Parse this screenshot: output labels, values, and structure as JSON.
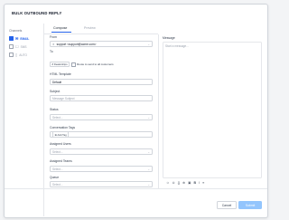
{
  "modal": {
    "title": "BULK OUTBOUND REPLY"
  },
  "channels": {
    "heading": "Channels",
    "items": [
      {
        "label": "EMAIL",
        "icon": "mail-icon",
        "active": true
      },
      {
        "label": "SMS",
        "icon": "phone-icon",
        "active": false
      },
      {
        "label": "AUTO",
        "icon": "device-icon",
        "active": false
      }
    ]
  },
  "tabs": [
    {
      "label": "Compose",
      "active": true
    },
    {
      "label": "Preview",
      "active": false
    }
  ],
  "form": {
    "from_label": "From",
    "from_value": "support <support@acme.com>",
    "to_label": "To",
    "to_chip": "# Dealerships",
    "to_toggle_label": "Route to send to all customers",
    "template_label": "HTML Template",
    "template_value": "Default",
    "subject_label": "Subject",
    "subject_placeholder": "Message Subject",
    "status_label": "Status",
    "status_placeholder": "Select...",
    "tags_label": "Conversation Tags",
    "tags_chip": "⊕ Add Tag",
    "users_label": "Assigned Users",
    "users_placeholder": "Select...",
    "teams_label": "Assigned Teams",
    "teams_placeholder": "Select...",
    "queue_label": "Queue",
    "queue_placeholder": "Select..."
  },
  "message": {
    "label": "Message",
    "placeholder": "Start a message..."
  },
  "footer": {
    "cancel_label": "Cancel",
    "submit_label": "Submit"
  },
  "colors": {
    "accent": "#2563eb",
    "submit_disabled": "#93c5fd"
  }
}
